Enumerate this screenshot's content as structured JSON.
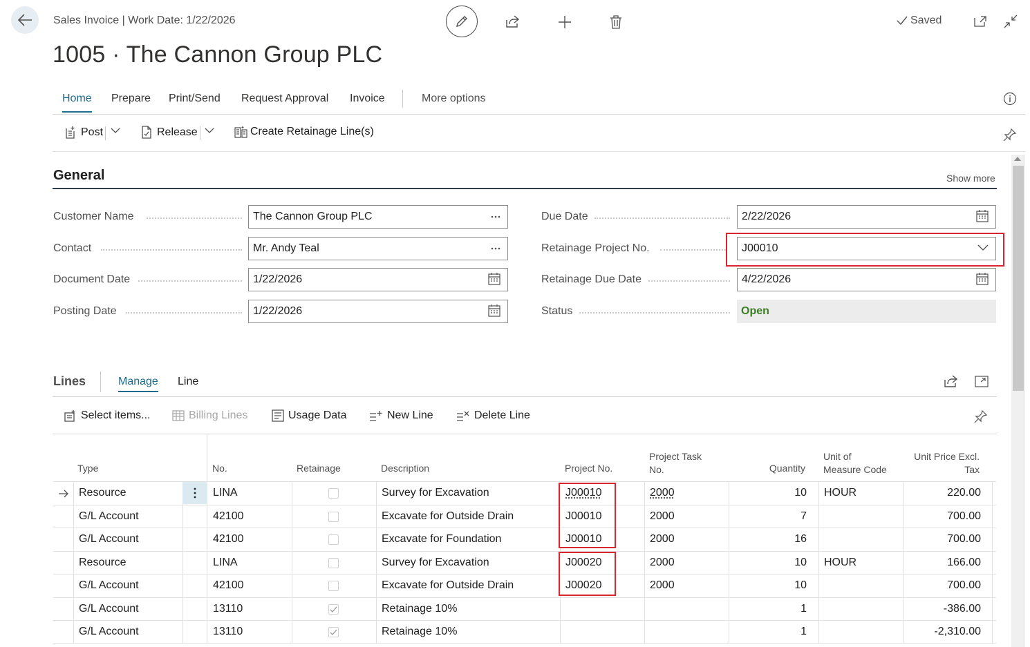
{
  "header": {
    "breadcrumb": "Sales Invoice | Work Date: 1/22/2026",
    "title": "1005 · The Cannon Group PLC",
    "saved_label": "Saved"
  },
  "tabs": [
    {
      "label": "Home"
    },
    {
      "label": "Prepare"
    },
    {
      "label": "Print/Send"
    },
    {
      "label": "Request Approval"
    },
    {
      "label": "Invoice"
    },
    {
      "label": "More options"
    }
  ],
  "actions": {
    "post": "Post",
    "release": "Release",
    "create_retainage": "Create Retainage Line(s)"
  },
  "general": {
    "title": "General",
    "show_more": "Show more",
    "customer_name": {
      "label": "Customer Name",
      "value": "The Cannon Group PLC"
    },
    "contact": {
      "label": "Contact",
      "value": "Mr. Andy Teal"
    },
    "document_date": {
      "label": "Document Date",
      "value": "1/22/2026"
    },
    "posting_date": {
      "label": "Posting Date",
      "value": "1/22/2026"
    },
    "due_date": {
      "label": "Due Date",
      "value": "2/22/2026"
    },
    "retainage_project_no": {
      "label": "Retainage Project No.",
      "value": "J00010"
    },
    "retainage_due_date": {
      "label": "Retainage Due Date",
      "value": "4/22/2026"
    },
    "status": {
      "label": "Status",
      "value": "Open"
    }
  },
  "lines": {
    "title": "Lines",
    "tab_manage": "Manage",
    "tab_line": "Line",
    "actions": {
      "select_items": "Select items...",
      "billing_lines": "Billing Lines",
      "usage_data": "Usage Data",
      "new_line": "New Line",
      "delete_line": "Delete Line"
    },
    "columns": {
      "type": "Type",
      "no": "No.",
      "retainage": "Retainage",
      "description": "Description",
      "project_no": "Project No.",
      "project_task_no_1": "Project Task",
      "project_task_no_2": "No.",
      "quantity": "Quantity",
      "uom_1": "Unit of",
      "uom_2": "Measure Code",
      "unit_price_1": "Unit Price Excl.",
      "unit_price_2": "Tax"
    },
    "rows": [
      {
        "type": "Resource",
        "no": "LINA",
        "retainage": false,
        "description": "Survey for Excavation",
        "project_no": "J00010",
        "project_task_no": "2000",
        "quantity": "10",
        "uom": "HOUR",
        "unit_price": "220.00"
      },
      {
        "type": "G/L Account",
        "no": "42100",
        "retainage": false,
        "description": "Excavate for Outside Drain",
        "project_no": "J00010",
        "project_task_no": "2000",
        "quantity": "7",
        "uom": "",
        "unit_price": "700.00"
      },
      {
        "type": "G/L Account",
        "no": "42100",
        "retainage": false,
        "description": "Excavate for Foundation",
        "project_no": "J00010",
        "project_task_no": "2000",
        "quantity": "16",
        "uom": "",
        "unit_price": "700.00"
      },
      {
        "type": "Resource",
        "no": "LINA",
        "retainage": false,
        "description": "Survey for Excavation",
        "project_no": "J00020",
        "project_task_no": "2000",
        "quantity": "10",
        "uom": "HOUR",
        "unit_price": "166.00"
      },
      {
        "type": "G/L Account",
        "no": "42100",
        "retainage": false,
        "description": "Excavate for Outside Drain",
        "project_no": "J00020",
        "project_task_no": "2000",
        "quantity": "10",
        "uom": "",
        "unit_price": "700.00"
      },
      {
        "type": "G/L Account",
        "no": "13110",
        "retainage": true,
        "description": "Retainage 10%",
        "project_no": "",
        "project_task_no": "",
        "quantity": "1",
        "uom": "",
        "unit_price": "-386.00"
      },
      {
        "type": "G/L Account",
        "no": "13110",
        "retainage": true,
        "description": "Retainage 10%",
        "project_no": "",
        "project_task_no": "",
        "quantity": "1",
        "uom": "",
        "unit_price": "-2,310.00"
      }
    ]
  },
  "colors": {
    "accent": "#1f6a8a",
    "highlight_border": "#d9262e",
    "status_open": "#3b7d23"
  },
  "icons": [
    "back-arrow-icon",
    "pencil-icon",
    "share-icon",
    "plus-icon",
    "trash-icon",
    "check-icon",
    "open-new-window-icon",
    "collapse-icon",
    "info-icon",
    "pin-icon",
    "calendar-icon",
    "ellipsis-icon",
    "chevron-down-icon",
    "row-arrow-icon"
  ]
}
